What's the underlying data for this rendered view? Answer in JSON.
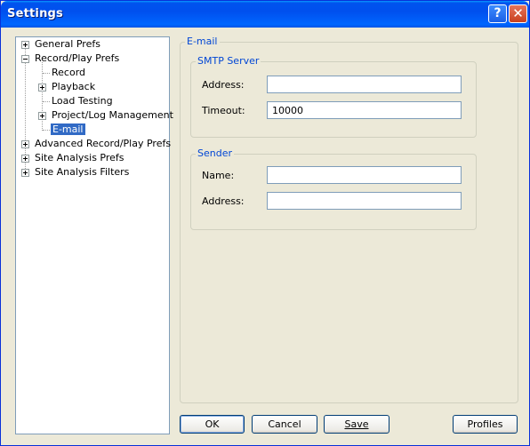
{
  "window": {
    "title": "Settings",
    "help_glyph": "?",
    "close_glyph": "✕"
  },
  "tree": {
    "items": [
      {
        "label": "General Prefs",
        "expander": "plus"
      },
      {
        "label": "Record/Play Prefs",
        "expander": "minus"
      },
      {
        "label": "Record",
        "expander": "none"
      },
      {
        "label": "Playback",
        "expander": "plus"
      },
      {
        "label": "Load Testing",
        "expander": "none"
      },
      {
        "label": "Project/Log Management",
        "expander": "plus"
      },
      {
        "label": "E-mail",
        "expander": "none",
        "selected": true
      },
      {
        "label": "Advanced Record/Play Prefs",
        "expander": "plus"
      },
      {
        "label": "Site Analysis Prefs",
        "expander": "plus"
      },
      {
        "label": "Site Analysis Filters",
        "expander": "plus"
      }
    ]
  },
  "panel": {
    "title": "E-mail",
    "smtp": {
      "title": "SMTP Server",
      "address_label": "Address:",
      "address_value": "",
      "timeout_label": "Timeout:",
      "timeout_value": "10000"
    },
    "sender": {
      "title": "Sender",
      "name_label": "Name:",
      "name_value": "",
      "address_label": "Address:",
      "address_value": ""
    }
  },
  "buttons": {
    "ok": "OK",
    "cancel": "Cancel",
    "save": "Save",
    "profiles": "Profiles"
  },
  "colors": {
    "titlebar": "#0054e3",
    "selection": "#316ac5",
    "legend": "#0046d5",
    "face": "#ece9d8"
  }
}
